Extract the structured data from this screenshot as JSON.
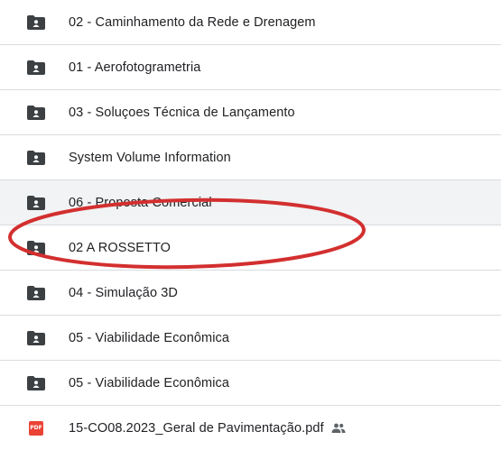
{
  "rows": [
    {
      "name": "02 - Caminhamento da Rede e Drenagem",
      "icon": "folder-shared-icon"
    },
    {
      "name": "01 - Aerofotogrametria",
      "icon": "folder-shared-icon"
    },
    {
      "name": "03 - Soluçoes Técnica de Lançamento",
      "icon": "folder-shared-icon"
    },
    {
      "name": "System Volume Information",
      "icon": "folder-shared-icon"
    },
    {
      "name": "06 - Proposta Comercial",
      "icon": "folder-shared-icon"
    },
    {
      "name": "02 A ROSSETTO",
      "icon": "folder-shared-icon"
    },
    {
      "name": "04 - Simulação 3D",
      "icon": "folder-shared-icon"
    },
    {
      "name": "05 - Viabilidade Econômica",
      "icon": "folder-shared-icon"
    },
    {
      "name": "15-CO08.2023_Geral de Pavimentação.pdf",
      "icon": "pdf-icon",
      "pdf_badge": "PDF",
      "shared": true
    }
  ],
  "highlighted_index": 4,
  "colors": {
    "folder": "#3c4043",
    "pdf": "#ea4335",
    "annotation": "#d32f2f",
    "highlight_bg": "#f1f3f4",
    "divider": "#dadce0"
  }
}
